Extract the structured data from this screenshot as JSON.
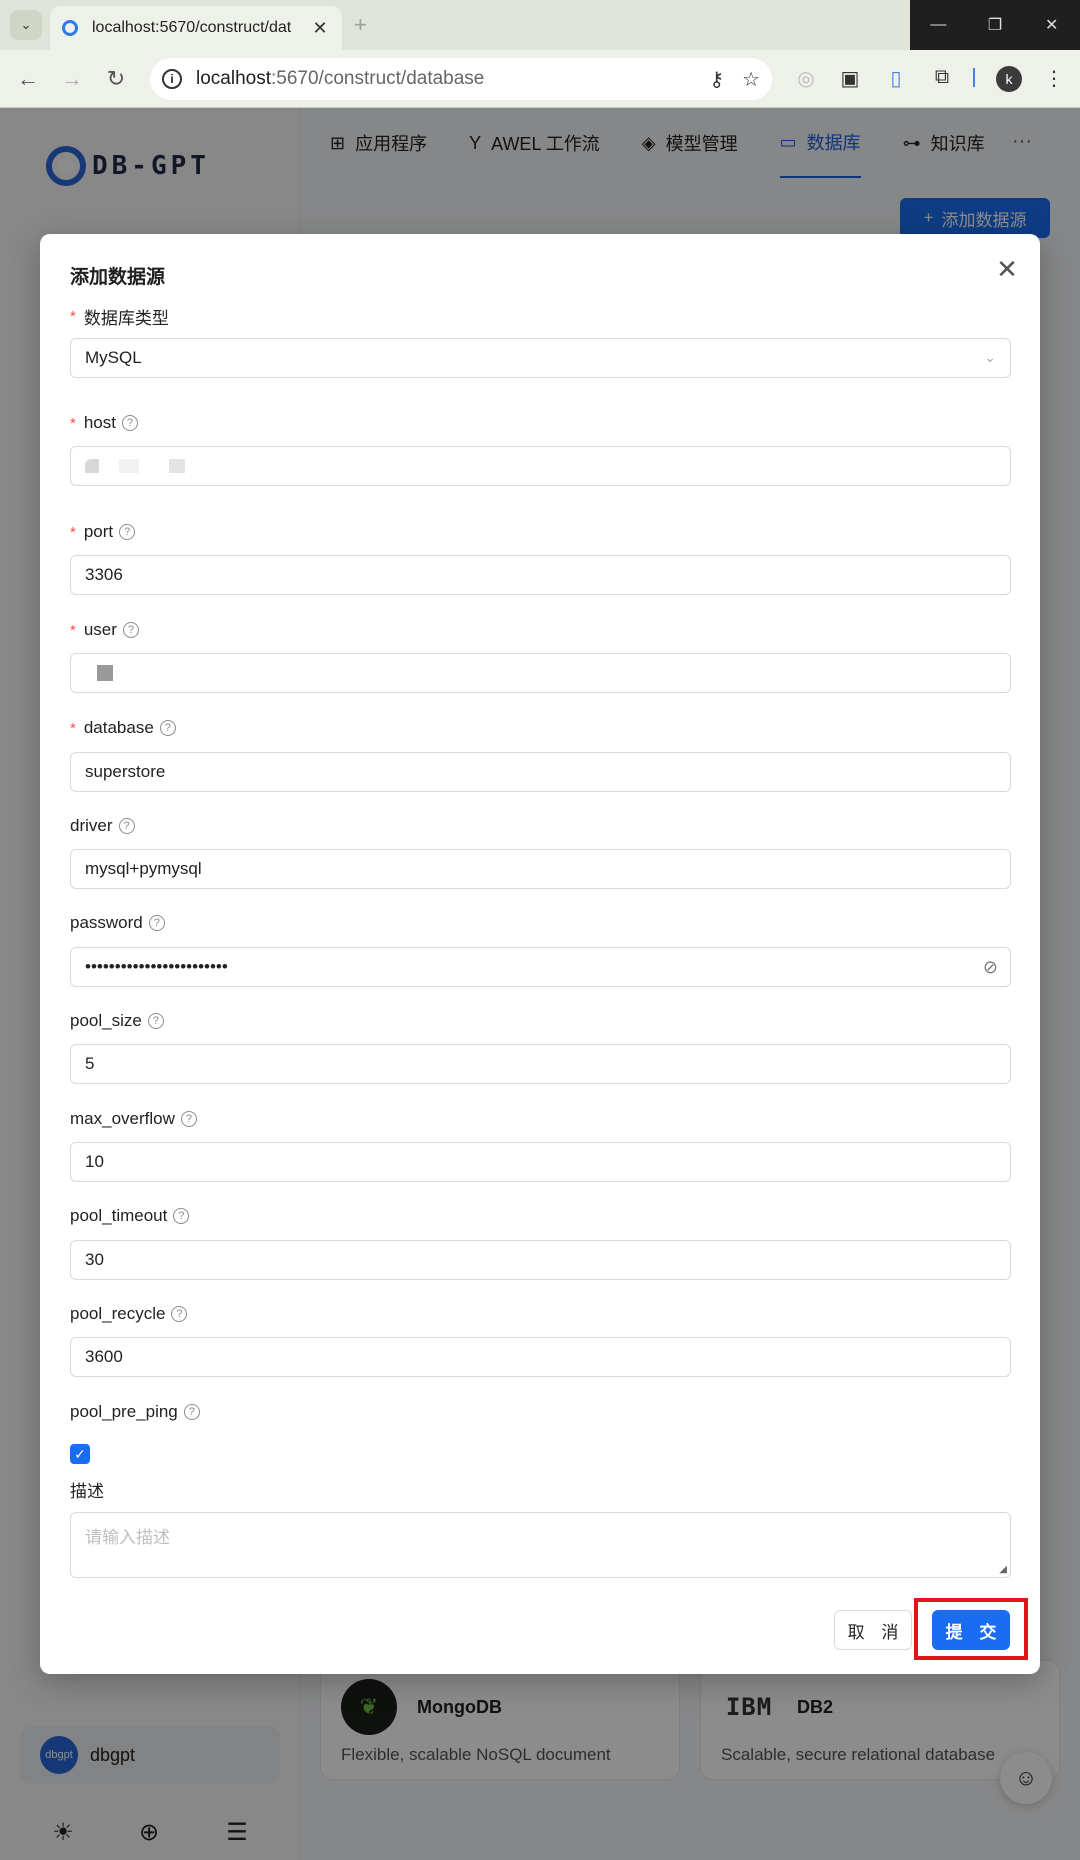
{
  "browser": {
    "tab_title": "localhost:5670/construct/dat",
    "url_host": "localhost",
    "url_rest": ":5670/construct/database",
    "profile_initial": "k"
  },
  "app": {
    "logo_text": "DB-GPT",
    "nav_tabs": [
      {
        "label": "应用程序",
        "icon": "grid-icon"
      },
      {
        "label": "AWEL 工作流",
        "icon": "flow-icon"
      },
      {
        "label": "模型管理",
        "icon": "cube-icon"
      },
      {
        "label": "数据库",
        "icon": "monitor-icon"
      },
      {
        "label": "知识库",
        "icon": "knowledge-icon"
      }
    ],
    "add_datasource_button": "添加数据源",
    "user": {
      "avatar": "dbgpt",
      "name": "dbgpt"
    },
    "cards": [
      {
        "title": "MongoDB",
        "desc": "Flexible, scalable NoSQL document"
      },
      {
        "title": "DB2",
        "logo": "IBM",
        "desc": "Scalable, secure relational database"
      }
    ]
  },
  "modal": {
    "title": "添加数据源",
    "fields": {
      "db_type": {
        "label": "数据库类型",
        "value": "MySQL"
      },
      "host": {
        "label": "host"
      },
      "port": {
        "label": "port",
        "value": "3306"
      },
      "user": {
        "label": "user"
      },
      "database": {
        "label": "database",
        "value": "superstore"
      },
      "driver": {
        "label": "driver",
        "value": "mysql+pymysql"
      },
      "password": {
        "label": "password",
        "value": "••••••••••••••••••••••••"
      },
      "pool_size": {
        "label": "pool_size",
        "value": "5"
      },
      "max_overflow": {
        "label": "max_overflow",
        "value": "10"
      },
      "pool_timeout": {
        "label": "pool_timeout",
        "value": "30"
      },
      "pool_recycle": {
        "label": "pool_recycle",
        "value": "3600"
      },
      "pool_pre_ping": {
        "label": "pool_pre_ping",
        "checked": true
      },
      "description": {
        "label": "描述",
        "placeholder": "请输入描述"
      }
    },
    "cancel_label": "取 消",
    "submit_label": "提 交"
  },
  "colors": {
    "primary": "#1a6df0",
    "required": "#ff4d4f",
    "highlight": "#e3141a"
  }
}
